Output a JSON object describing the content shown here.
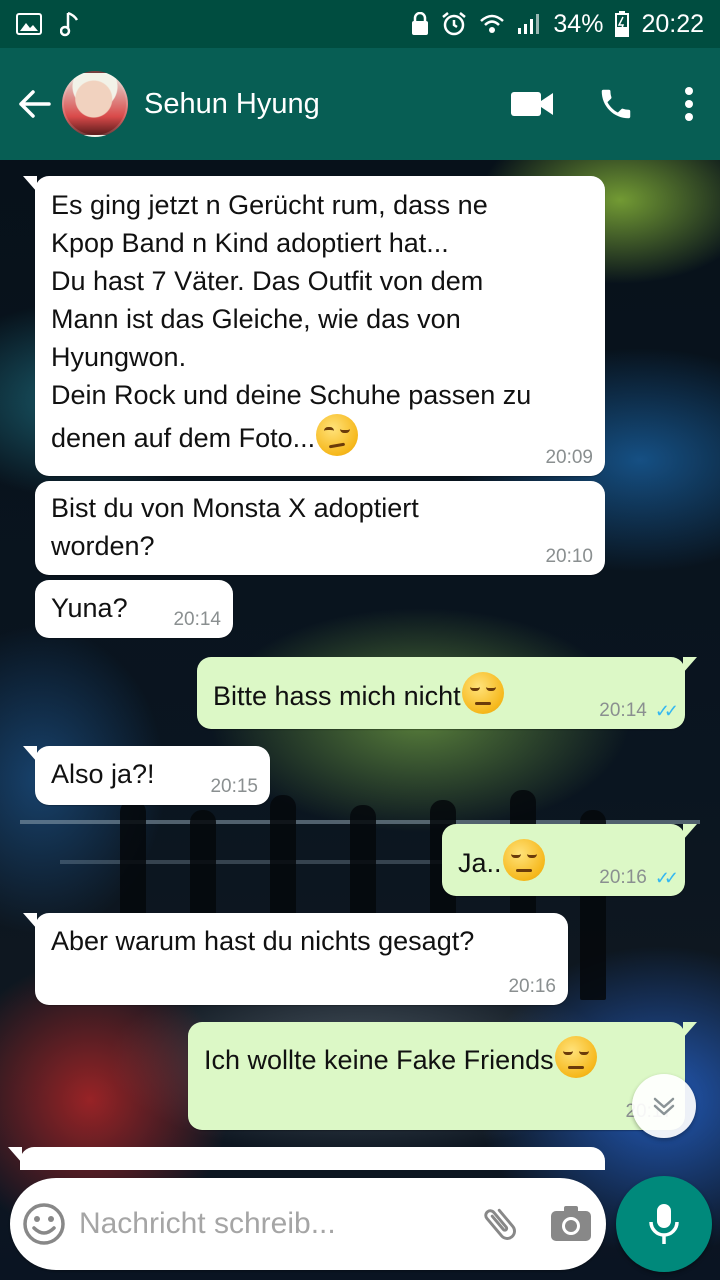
{
  "status_bar": {
    "battery": "34%",
    "time": "20:22"
  },
  "header": {
    "contact_name": "Sehun Hyung"
  },
  "messages": [
    {
      "dir": "in",
      "text": "Es ging jetzt n Gerücht rum, dass ne\nKpop Band n Kind adoptiert hat...\nDu hast 7 Väter. Das Outfit von dem\nMann ist das Gleiche, wie das von\nHyungwon.\nDein Rock und deine Schuhe passen zu\ndenen auf dem Foto...",
      "emoji": "raised-eyebrow",
      "time": "20:09"
    },
    {
      "dir": "in",
      "text": "Bist du von Monsta X adoptiert\nworden?",
      "time": "20:10"
    },
    {
      "dir": "in",
      "text": "Yuna?",
      "time": "20:14"
    },
    {
      "dir": "out",
      "text": "Bitte hass mich nicht",
      "emoji": "pensive",
      "time": "20:14",
      "read": true
    },
    {
      "dir": "in",
      "text": "Also ja?!",
      "time": "20:15"
    },
    {
      "dir": "out",
      "text": "Ja..",
      "emoji": "pensive",
      "time": "20:16",
      "read": true
    },
    {
      "dir": "in",
      "text": "Aber warum hast du nichts gesagt?",
      "time": "20:16"
    },
    {
      "dir": "out",
      "text": "Ich wollte keine Fake Friends",
      "emoji": "pensive",
      "time": "20:17",
      "read": false
    }
  ],
  "input": {
    "placeholder": "Nachricht schreib..."
  },
  "colors": {
    "toolbar": "#075e54",
    "status_bar": "#004d40",
    "outgoing_bubble": "#dcf8c6",
    "incoming_bubble": "#ffffff",
    "mic_button": "#00897b",
    "read_ticks": "#34b7f1"
  },
  "icons": [
    "gallery-icon",
    "music-note-icon",
    "lock-icon",
    "alarm-icon",
    "wifi-icon",
    "signal-icon",
    "battery-icon",
    "back-arrow-icon",
    "video-call-icon",
    "phone-call-icon",
    "overflow-menu-icon",
    "emoji-icon",
    "attach-icon",
    "camera-icon",
    "mic-icon",
    "chevron-double-down-icon"
  ]
}
